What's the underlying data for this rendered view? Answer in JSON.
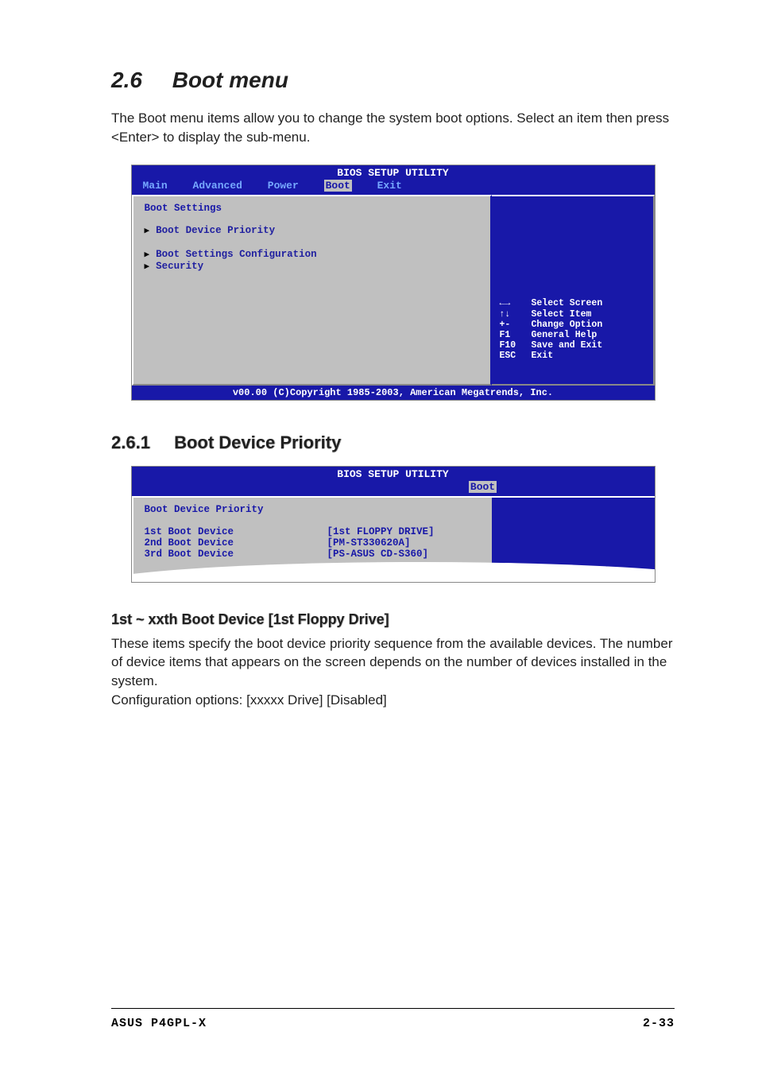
{
  "heading": {
    "num": "2.6",
    "title": "Boot menu"
  },
  "intro": "The Boot menu items allow you to change the system boot options. Select an item then press <Enter> to display the sub-menu.",
  "bios1": {
    "utility_title": "BIOS SETUP UTILITY",
    "menu": {
      "main": "Main",
      "advanced": "Advanced",
      "power": "Power",
      "boot": "Boot",
      "exit": "Exit"
    },
    "left_title": "Boot Settings",
    "items": {
      "priority": "Boot Device Priority",
      "config": "Boot Settings Configuration",
      "security": "Security"
    },
    "help": {
      "r0k": "←→",
      "r0v": "Select Screen",
      "r1k": "↑↓",
      "r1v": "Select Item",
      "r2k": "+-",
      "r2v": "Change Option",
      "r3k": "F1",
      "r3v": "General Help",
      "r4k": "F10",
      "r4v": "Save and Exit",
      "r5k": "ESC",
      "r5v": "Exit"
    },
    "footer": "v00.00 (C)Copyright 1985-2003, American Megatrends, Inc."
  },
  "sub": {
    "num": "2.6.1",
    "title": "Boot Device Priority"
  },
  "bios2": {
    "utility_title": "BIOS SETUP UTILITY",
    "tab": "Boot",
    "left_title": "Boot Device Priority",
    "rows": {
      "r0l": "1st Boot Device",
      "r0v": "[1st FLOPPY DRIVE]",
      "r1l": "2nd Boot Device",
      "r1v": "[PM-ST330620A]",
      "r2l": "3rd Boot Device",
      "r2v": "[PS-ASUS CD-S360]"
    }
  },
  "option": {
    "title": "1st ~ xxth Boot Device [1st Floppy Drive]",
    "text1": "These items specify the boot device priority sequence from the available devices. The number of device items that appears on the screen depends on the number of devices installed in the system.",
    "text2": "Configuration options: [xxxxx Drive] [Disabled]"
  },
  "footer": {
    "left": "ASUS P4GPL-X",
    "right": "2-33"
  }
}
